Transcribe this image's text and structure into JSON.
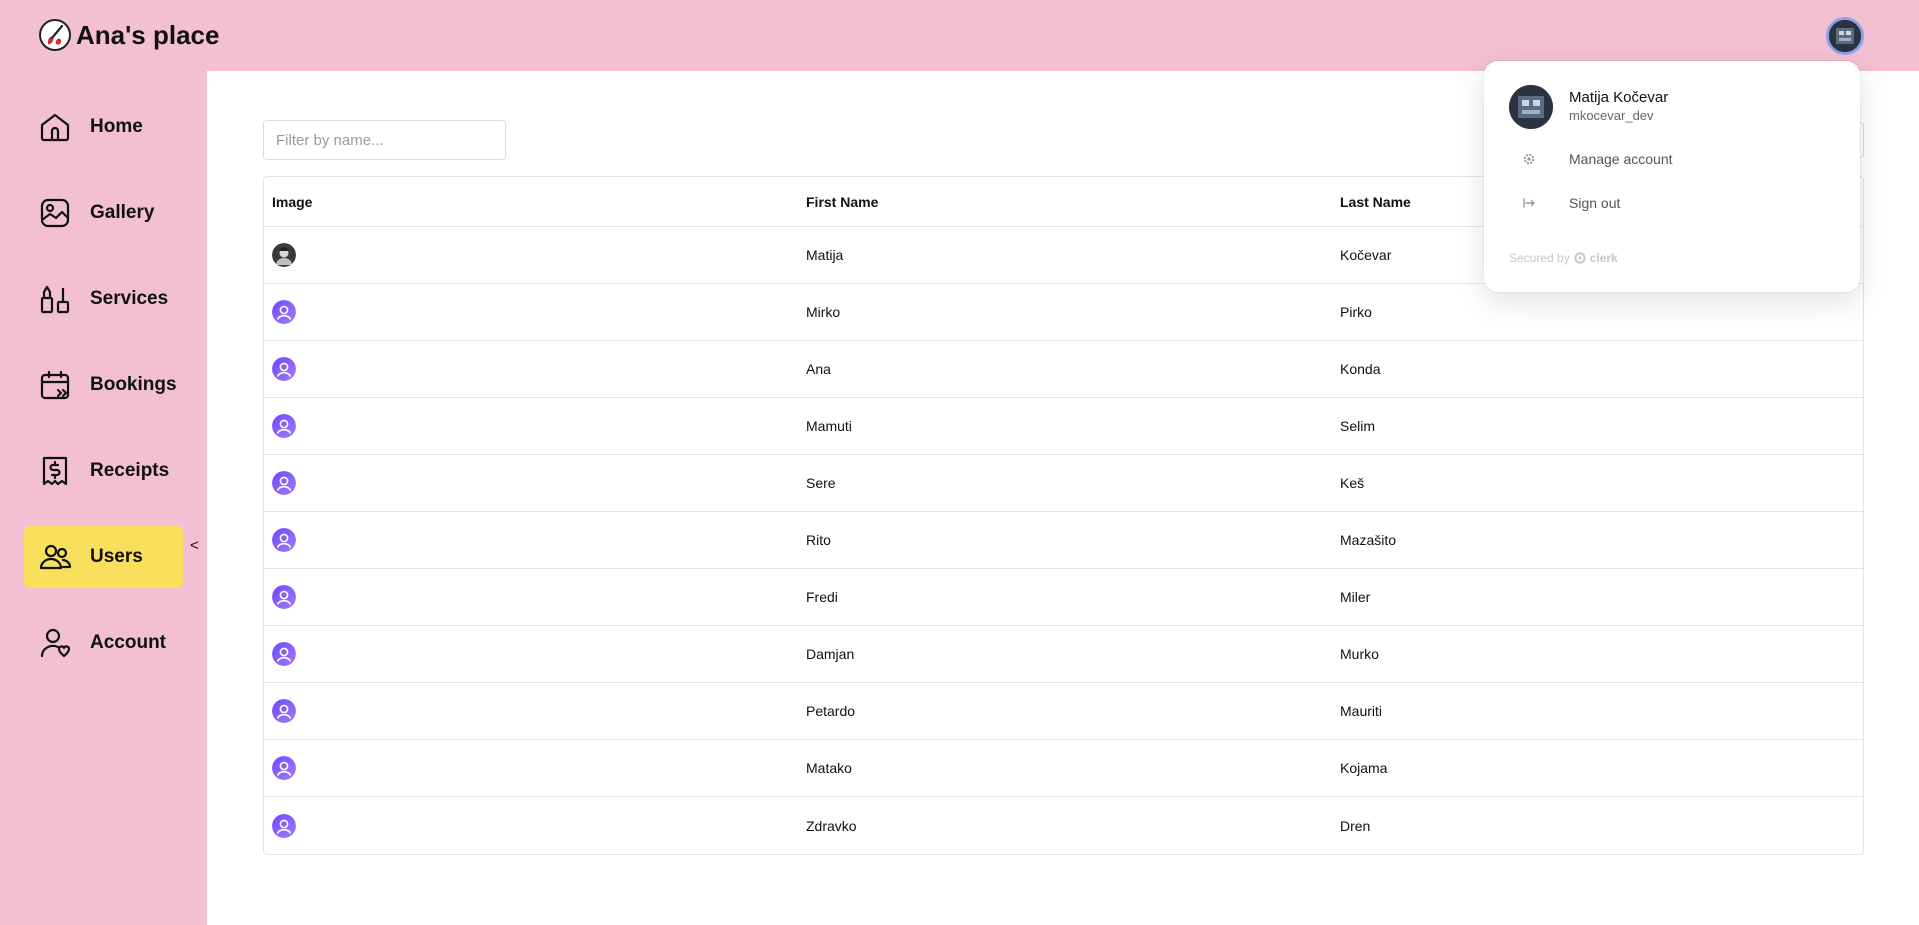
{
  "header": {
    "title": "Ana's place",
    "logo_icon": "paint-brush-logo-icon",
    "user_avatar_icon": "user-avatar-icon"
  },
  "sidebar": {
    "items": [
      {
        "label": "Home",
        "icon": "home-icon",
        "active": false
      },
      {
        "label": "Gallery",
        "icon": "gallery-icon",
        "active": false
      },
      {
        "label": "Services",
        "icon": "services-icon",
        "active": false
      },
      {
        "label": "Bookings",
        "icon": "calendar-icon",
        "active": false
      },
      {
        "label": "Receipts",
        "icon": "receipt-icon",
        "active": false
      },
      {
        "label": "Users",
        "icon": "users-icon",
        "active": true
      },
      {
        "label": "Account",
        "icon": "account-icon",
        "active": false
      }
    ],
    "collapse_label": "<",
    "active_color": "#f8e05c"
  },
  "main": {
    "filter": {
      "placeholder": "Filter by name...",
      "value": ""
    },
    "table": {
      "columns": [
        "Image",
        "First Name",
        "Last Name"
      ],
      "rows": [
        {
          "first": "Matija",
          "last": "Kočevar",
          "avatar": "photo"
        },
        {
          "first": "Mirko",
          "last": "Pirko",
          "avatar": "default"
        },
        {
          "first": "Ana",
          "last": "Konda",
          "avatar": "default"
        },
        {
          "first": "Mamuti",
          "last": "Selim",
          "avatar": "default"
        },
        {
          "first": "Sere",
          "last": "Keš",
          "avatar": "default"
        },
        {
          "first": "Rito",
          "last": "Mazašito",
          "avatar": "default"
        },
        {
          "first": "Fredi",
          "last": "Miler",
          "avatar": "default"
        },
        {
          "first": "Damjan",
          "last": "Murko",
          "avatar": "default"
        },
        {
          "first": "Petardo",
          "last": "Mauriti",
          "avatar": "default"
        },
        {
          "first": "Matako",
          "last": "Kojama",
          "avatar": "default"
        },
        {
          "first": "Zdravko",
          "last": "Dren",
          "avatar": "default"
        }
      ]
    }
  },
  "popover": {
    "name": "Matija Kočevar",
    "username": "mkocevar_dev",
    "manage_label": "Manage account",
    "signout_label": "Sign out",
    "secured_label": "Secured by",
    "secured_brand": "clerk"
  },
  "colors": {
    "background": "#f2bfd3",
    "accent": "#f8e05c",
    "avatar_gradient_start": "#6c47ff",
    "avatar_gradient_end": "#a47cf5"
  }
}
